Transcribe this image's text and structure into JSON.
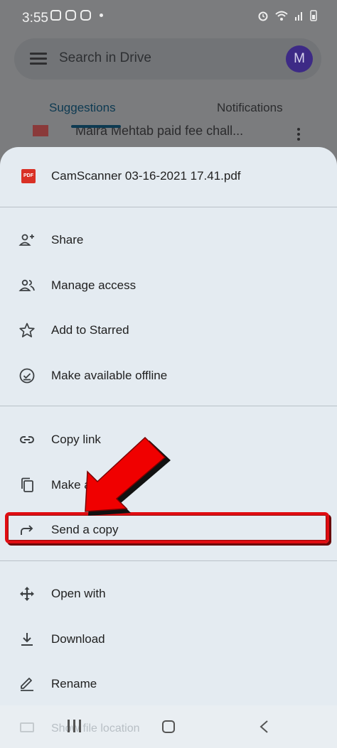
{
  "status_bar": {
    "time": "3:55"
  },
  "background": {
    "search_placeholder": "Search in Drive",
    "avatar_initial": "M",
    "tabs": [
      {
        "label": "Suggestions",
        "selected": true
      },
      {
        "label": "Notifications",
        "selected": false
      }
    ],
    "file_row_name": "Maira Mehtab paid fee chall..."
  },
  "sheet": {
    "file_icon_label": "PDF",
    "file_title": "CamScanner 03-16-2021 17.41.pdf",
    "groups": [
      {
        "items": [
          {
            "label": "Share",
            "icon": "add-person-icon"
          },
          {
            "label": "Manage access",
            "icon": "people-icon"
          },
          {
            "label": "Add to Starred",
            "icon": "star-outline-icon"
          },
          {
            "label": "Make available offline",
            "icon": "offline-check-icon"
          }
        ]
      },
      {
        "items": [
          {
            "label": "Copy link",
            "icon": "link-icon"
          },
          {
            "label": "Make a",
            "icon": "copy-icon"
          },
          {
            "label": "Send a copy",
            "icon": "send-arrow-icon",
            "highlighted": true
          }
        ]
      },
      {
        "items": [
          {
            "label": "Open with",
            "icon": "open-with-icon"
          },
          {
            "label": "Download",
            "icon": "download-icon"
          },
          {
            "label": "Rename",
            "icon": "pencil-icon"
          }
        ]
      }
    ],
    "partial_item_label": "Show file location"
  },
  "colors": {
    "highlight_border": "#e00d12",
    "arrow_fill": "#f00000",
    "sheet_bg": "#e4ebf1",
    "accent": "#0d3a52"
  }
}
